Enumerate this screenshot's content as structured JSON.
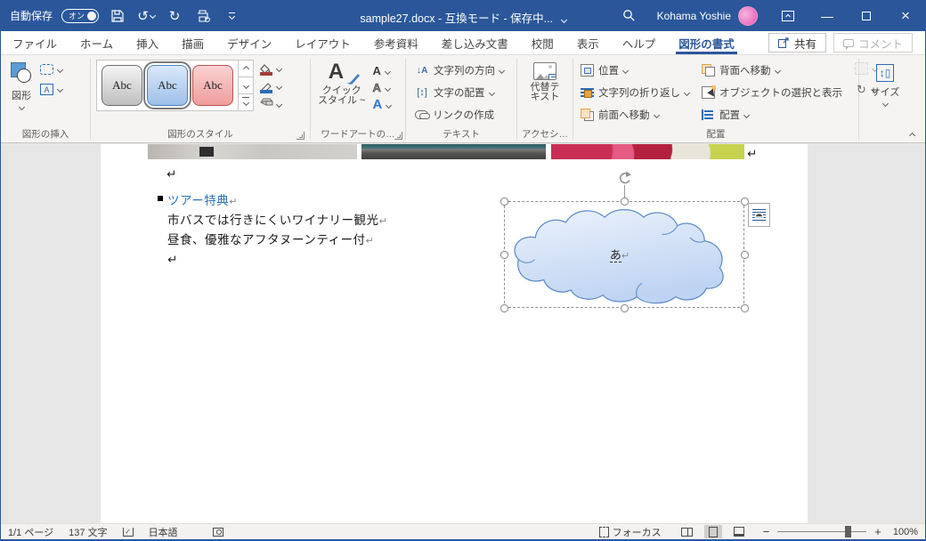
{
  "colors": {
    "accent": "#2b579a",
    "heading": "#2e75b6",
    "cloud_stroke": "#5e8cc8",
    "cloud_fill_top": "#eaf1fb",
    "cloud_fill_bottom": "#bfd4f2"
  },
  "titlebar": {
    "autosave_label": "自動保存",
    "autosave_state": "オン",
    "title": "sample27.docx  -  互換モード  -  保存中...",
    "user_name": "Kohama Yoshie"
  },
  "tabs": {
    "items": [
      "ファイル",
      "ホーム",
      "挿入",
      "描画",
      "デザイン",
      "レイアウト",
      "参考資料",
      "差し込み文書",
      "校閲",
      "表示",
      "ヘルプ",
      "図形の書式"
    ]
  },
  "actions": {
    "share": "共有",
    "comments": "コメント"
  },
  "ribbon": {
    "insert_shapes": {
      "label": "図形の挿入",
      "shapes": "図形"
    },
    "shape_styles": {
      "label": "図形のスタイル",
      "gallery": [
        "Abc",
        "Abc",
        "Abc"
      ]
    },
    "wordart": {
      "label": "ワードアートの…",
      "quick1": "クイック",
      "quick2": "スタイル ~"
    },
    "textgrp": {
      "label": "テキスト",
      "direction": "文字列の方向",
      "valign": "文字の配置",
      "link": "リンクの作成"
    },
    "accessibility": {
      "label": "アクセシ…",
      "alt1": "代替テ",
      "alt2": "キスト"
    },
    "arrange": {
      "label": "配置",
      "position": "位置",
      "wrap": "文字列の折り返し",
      "forward": "前面へ移動",
      "backward": "背面へ移動",
      "selection_pane": "オブジェクトの選択と表示",
      "align": "配置"
    },
    "size": {
      "button": "サイズ"
    }
  },
  "document": {
    "heading": "ツアー特典",
    "body1": "市バスでは行きにくいワイナリー観光",
    "body2": "昼食、優雅なアフタヌーンティー付",
    "pilcrow": "↵",
    "cloud_text": "あ"
  },
  "statusbar": {
    "page": "1/1 ページ",
    "chars": "137 文字",
    "language": "日本語",
    "focus": "フォーカス",
    "zoom_level": "100%",
    "minus": "−",
    "plus": "+"
  },
  "glyphs": {
    "undo": "↺",
    "redo": "↻",
    "rotate": "↻",
    "dirdown": "↓",
    "a": "A",
    "updown": "↕",
    "check": "✓",
    "abc_gray": "Abc"
  }
}
